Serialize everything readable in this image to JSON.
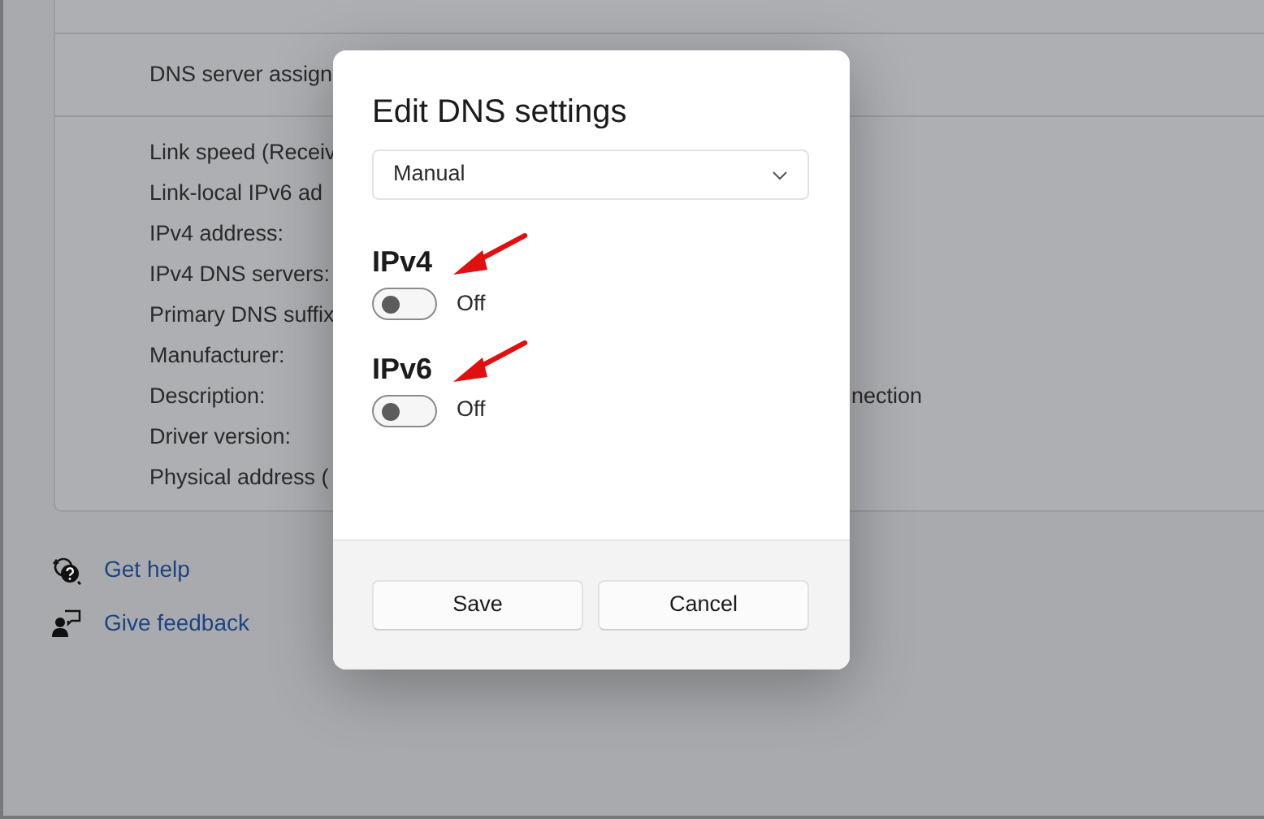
{
  "details_panel": {
    "dns_row": {
      "label": "DNS server assign"
    },
    "rows": [
      {
        "label": "Link speed (Receiv"
      },
      {
        "label": "Link-local IPv6 ad"
      },
      {
        "label": "IPv4 address:"
      },
      {
        "label": "IPv4 DNS servers:"
      },
      {
        "label": "Primary DNS suffix"
      },
      {
        "label": "Manufacturer:"
      },
      {
        "label": "Description:",
        "value": "nection"
      },
      {
        "label": "Driver version:"
      },
      {
        "label": "Physical address ("
      }
    ]
  },
  "help_links": [
    {
      "kind": "help",
      "label": "Get help"
    },
    {
      "kind": "feedback",
      "label": "Give feedback"
    }
  ],
  "dialog": {
    "title": "Edit DNS settings",
    "dropdown": {
      "value": "Manual"
    },
    "sections": [
      {
        "heading": "IPv4",
        "toggle": {
          "on": false,
          "label": "Off"
        },
        "annotated": true
      },
      {
        "heading": "IPv6",
        "toggle": {
          "on": false,
          "label": "Off"
        },
        "annotated": true
      }
    ],
    "buttons": [
      "Save",
      "Cancel"
    ]
  }
}
